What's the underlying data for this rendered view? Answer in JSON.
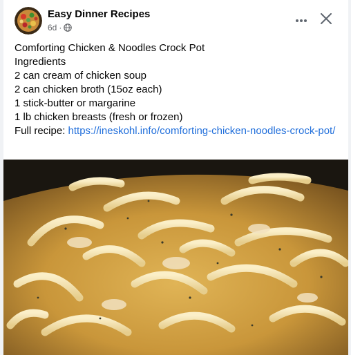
{
  "post": {
    "author": "Easy Dinner Recipes",
    "time": "6d",
    "separator": "·",
    "audience_icon": "globe-icon",
    "more_icon": "more-horizontal-icon",
    "close_icon": "close-icon",
    "lines": [
      "Comforting Chicken & Noodles Crock Pot",
      "Ingredients",
      "2 can cream of chicken soup",
      "2 can chicken broth (15oz each)",
      "1 stick-butter or margarine",
      "1 lb chicken breasts (fresh or frozen)"
    ],
    "full_recipe_label": "Full recipe:",
    "link_text": "https://ineskohl.info/comforting-chicken-noodles-crock-pot/",
    "link_color": "#216fdb"
  }
}
